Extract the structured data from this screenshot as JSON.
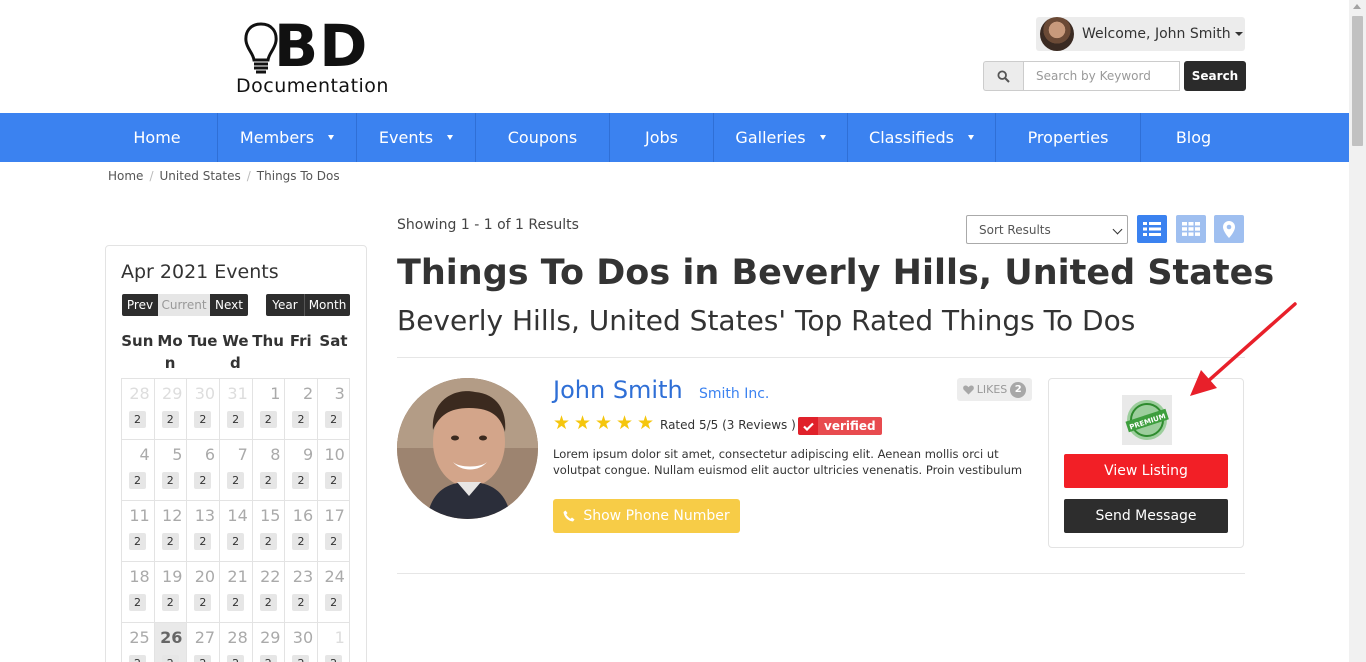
{
  "header": {
    "logo_main": "BD",
    "logo_sub": "Documentation",
    "welcome": "Welcome, John Smith",
    "search_placeholder": "Search by Keyword",
    "search_button": "Search"
  },
  "nav": {
    "items": [
      {
        "label": "Home",
        "dropdown": false
      },
      {
        "label": "Members",
        "dropdown": true
      },
      {
        "label": "Events",
        "dropdown": true
      },
      {
        "label": "Coupons",
        "dropdown": false
      },
      {
        "label": "Jobs",
        "dropdown": false
      },
      {
        "label": "Galleries",
        "dropdown": true
      },
      {
        "label": "Classifieds",
        "dropdown": true
      },
      {
        "label": "Properties",
        "dropdown": false
      },
      {
        "label": "Blog",
        "dropdown": false
      }
    ]
  },
  "breadcrumb": [
    "Home",
    "United States",
    "Things To Dos"
  ],
  "calendar": {
    "title": "Apr 2021 Events",
    "buttons_left": [
      "Prev",
      "Current",
      "Next"
    ],
    "buttons_right": [
      "Year",
      "Month"
    ],
    "weekdays": [
      "Sun",
      "Mon",
      "Tue",
      "Wed",
      "Thu",
      "Fri",
      "Sat"
    ],
    "weeks": [
      [
        {
          "d": "28",
          "o": true
        },
        {
          "d": "29",
          "o": true
        },
        {
          "d": "30",
          "o": true
        },
        {
          "d": "31",
          "o": true
        },
        {
          "d": "1"
        },
        {
          "d": "2"
        },
        {
          "d": "3"
        }
      ],
      [
        {
          "d": "4"
        },
        {
          "d": "5"
        },
        {
          "d": "6"
        },
        {
          "d": "7"
        },
        {
          "d": "8"
        },
        {
          "d": "9"
        },
        {
          "d": "10"
        }
      ],
      [
        {
          "d": "11"
        },
        {
          "d": "12"
        },
        {
          "d": "13"
        },
        {
          "d": "14"
        },
        {
          "d": "15"
        },
        {
          "d": "16"
        },
        {
          "d": "17"
        }
      ],
      [
        {
          "d": "18"
        },
        {
          "d": "19"
        },
        {
          "d": "20"
        },
        {
          "d": "21"
        },
        {
          "d": "22"
        },
        {
          "d": "23"
        },
        {
          "d": "24"
        }
      ],
      [
        {
          "d": "25"
        },
        {
          "d": "26",
          "today": true
        },
        {
          "d": "27"
        },
        {
          "d": "28"
        },
        {
          "d": "29"
        },
        {
          "d": "30"
        },
        {
          "d": "1",
          "o": true
        }
      ]
    ],
    "event_count": "2"
  },
  "results": {
    "showing": "Showing 1 - 1 of 1 Results",
    "sort_label": "Sort Results",
    "title": "Things To Dos in Beverly Hills, United States",
    "subtitle": "Beverly Hills, United States' Top Rated Things To Dos"
  },
  "listing": {
    "name": "John Smith",
    "company": "Smith Inc.",
    "likes_label": "LIKES",
    "likes_count": "2",
    "rating": 5,
    "rated_text": "Rated 5/5 (3 Reviews )",
    "verified": "verified",
    "description": "Lorem ipsum dolor sit amet, consectetur adipiscing elit. Aenean mollis orci ut volutpat congue. Nullam euismod elit auctor ultricies venenatis. Proin vestibulum",
    "phone_button": "Show Phone Number",
    "badge_text": "PREMIUM",
    "view_button": "View Listing",
    "message_button": "Send Message"
  },
  "colors": {
    "nav_bg": "#3b82f0",
    "name_link": "#2f6fd6",
    "star": "#f5c60d",
    "view_listing": "#f21f26",
    "phone_button": "#f7cc47",
    "annotation_arrow": "#e8202a"
  }
}
